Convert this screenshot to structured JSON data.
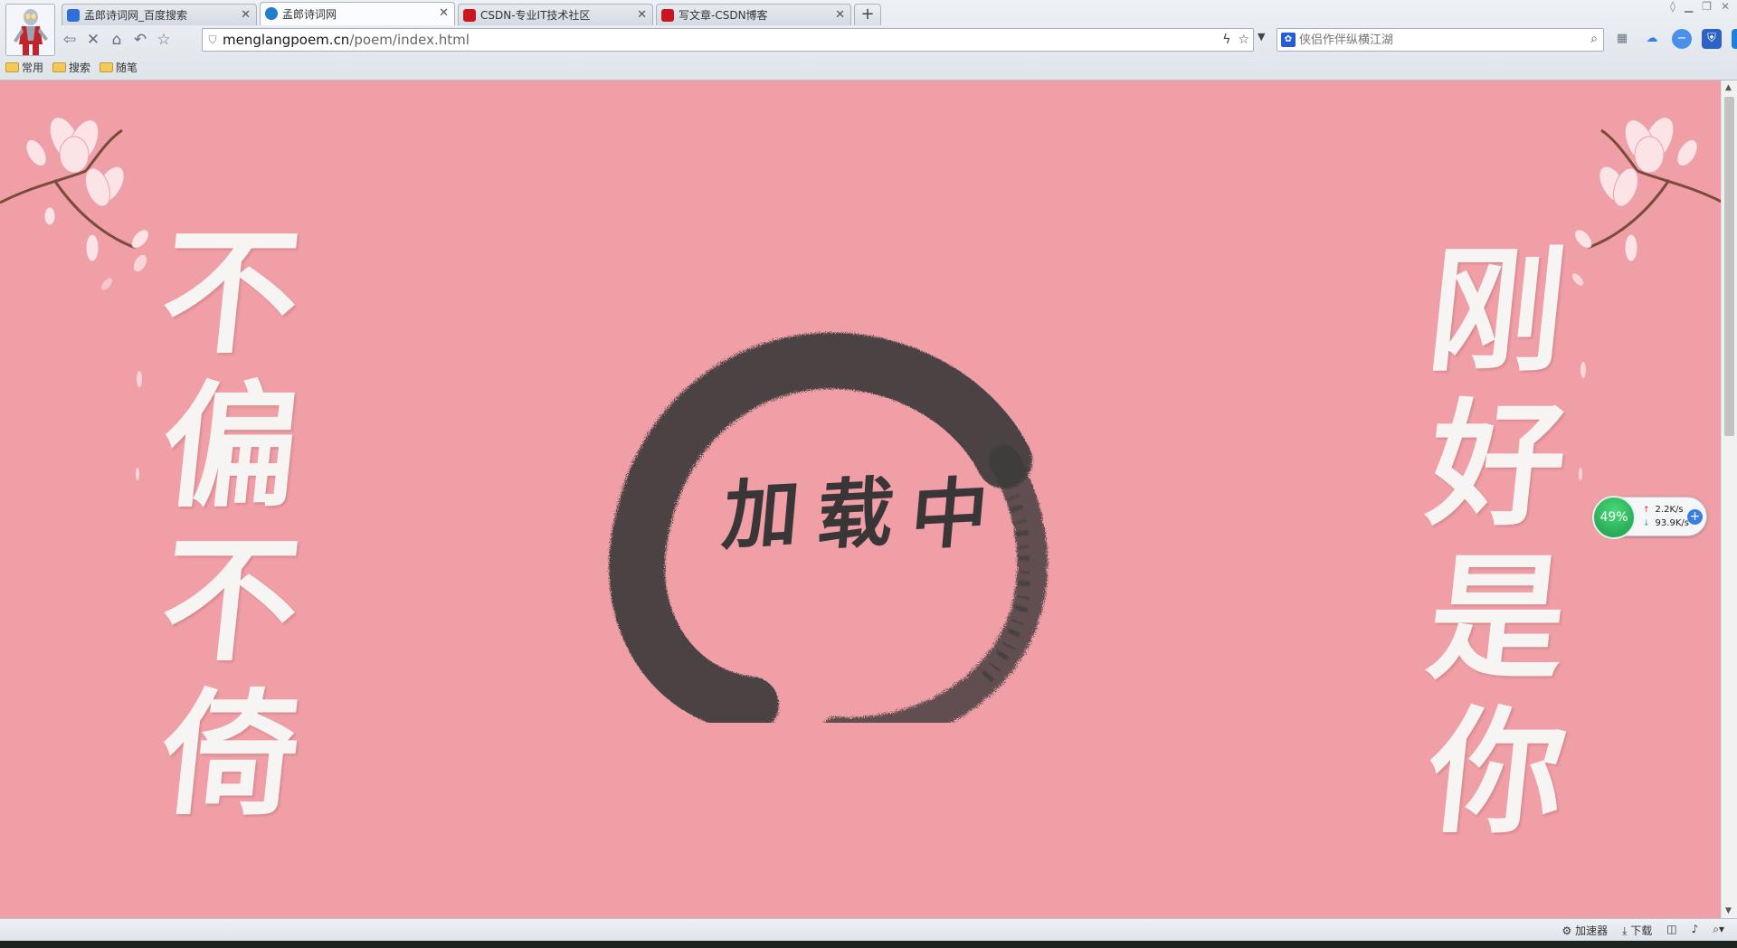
{
  "tabs": [
    {
      "label": "孟郎诗词网_百度搜索",
      "icon": "baidu-paw-icon",
      "color": "#2f6fd6",
      "active": false
    },
    {
      "label": "孟郎诗词网",
      "icon": "globe-icon",
      "color": "#1f7fc8",
      "active": true
    },
    {
      "label": "CSDN-专业IT技术社区",
      "icon": "csdn-icon",
      "color": "#c8171e",
      "active": false
    },
    {
      "label": "写文章-CSDN博客",
      "icon": "csdn-icon",
      "color": "#c8171e",
      "active": false
    }
  ],
  "address": {
    "domain": "menglangpoem.cn",
    "path": "/poem/index.html"
  },
  "search": {
    "placeholder": "侠侣作伴纵横江湖"
  },
  "bookmarks": [
    {
      "label": "常用"
    },
    {
      "label": "搜索"
    },
    {
      "label": "随笔"
    }
  ],
  "poem_left": [
    "不",
    "偏",
    "不",
    "倚"
  ],
  "poem_right": [
    "刚",
    "好",
    "是",
    "你"
  ],
  "loading_text": [
    "加",
    "载",
    "中"
  ],
  "net_widget": {
    "percent": "49%",
    "upload": "2.2K/s",
    "download": "93.9K/s"
  },
  "statusbar": {
    "adblock": "加速器",
    "download": "下载"
  },
  "colors": {
    "page_bg": "#ef9fa5",
    "ink": "#3a3637",
    "poem_text": "#f7f5f4"
  }
}
